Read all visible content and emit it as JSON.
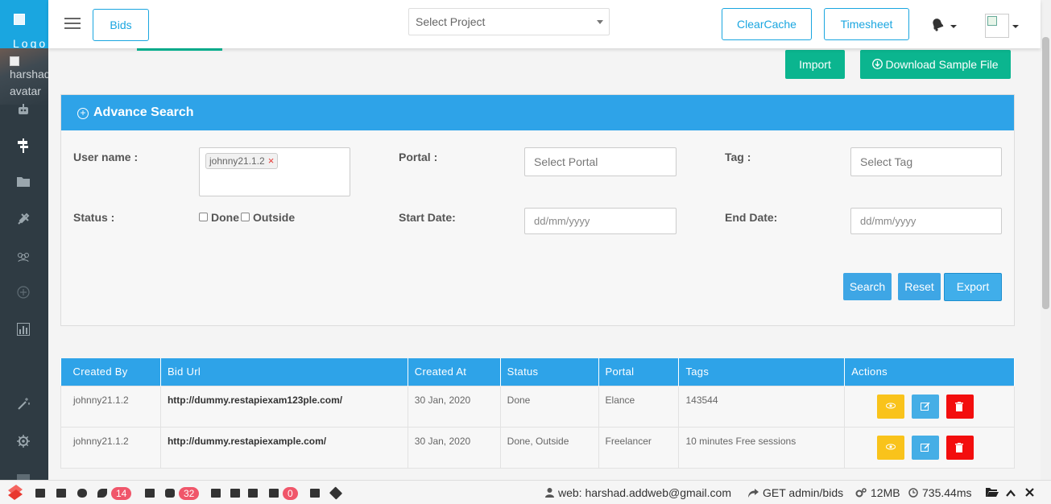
{
  "sidebar": {
    "logo_text": "Logo",
    "avatar_line1": "harshad",
    "avatar_line2": "avatar",
    "icons": [
      "robot-icon",
      "signpost-icon",
      "folder-icon",
      "tools-icon",
      "users-icon",
      "plus-circle-icon",
      "bar-chart-icon",
      "magic-wand-icon",
      "gear-icon",
      "list-icon"
    ]
  },
  "header": {
    "page_button": "Bids",
    "project_select_placeholder": "Select Project",
    "clear_cache": "ClearCache",
    "timesheet": "Timesheet"
  },
  "actions": {
    "import": "Import",
    "download_sample": "Download Sample File"
  },
  "advance_search": {
    "title": "Advance Search",
    "username_label": "User name :",
    "username_tag": "johnny21.1.2",
    "portal_label": "Portal :",
    "portal_placeholder": "Select Portal",
    "tag_label": "Tag :",
    "tag_placeholder": "Select Tag",
    "status_label": "Status :",
    "status_done": "Done",
    "status_outside": "Outside",
    "start_date_label": "Start Date:",
    "start_date_placeholder": "dd/mm/yyyy",
    "end_date_label": "End Date:",
    "end_date_placeholder": "dd/mm/yyyy",
    "search": "Search",
    "reset": "Reset",
    "export": "Export"
  },
  "table": {
    "columns": [
      "Created By",
      "Bid Url",
      "Created At",
      "Status",
      "Portal",
      "Tags",
      "Actions"
    ],
    "rows": [
      {
        "created_by": "johnny21.1.2",
        "bid_url": "http://dummy.restapiexam123ple.com/",
        "created_at": "30 Jan, 2020",
        "status": "Done",
        "portal": "Elance",
        "tags": "143544"
      },
      {
        "created_by": "johnny21.1.2",
        "bid_url": "http://dummy.restapiexample.com/",
        "created_at": "30 Jan, 2020",
        "status": "Done, Outside",
        "portal": "Freelancer",
        "tags": "10 minutes Free sessions"
      }
    ]
  },
  "debugbar": {
    "badge_views": "14",
    "badge_queries": "32",
    "badge_mail": "0",
    "user": "web: harshad.addweb@gmail.com",
    "route": "GET admin/bids",
    "memory": "12MB",
    "time": "735.44ms"
  },
  "colors": {
    "brand_blue": "#2ea3e8",
    "green": "#0bb58f",
    "view_yellow": "#f9c31b",
    "edit_blue": "#45aee6",
    "delete_red": "#f30e0e",
    "sidebar_dark": "#2f3b43"
  }
}
